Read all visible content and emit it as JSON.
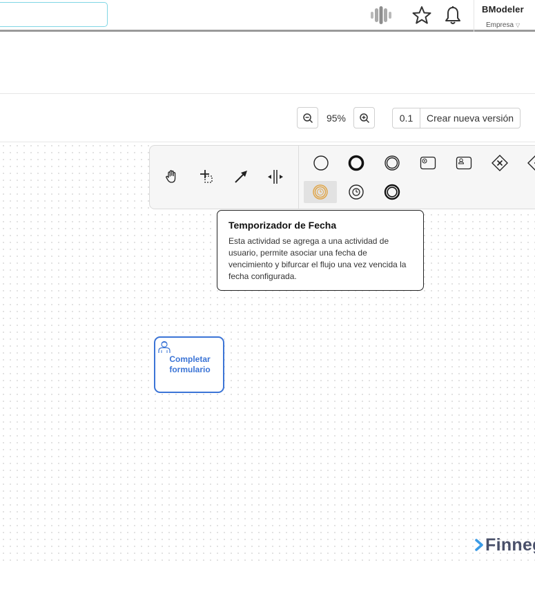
{
  "header": {
    "search_value": "",
    "user_name": "BModeler",
    "company": "Empresa",
    "icons": [
      "brand-logo-icon",
      "star-icon",
      "bell-icon",
      "chevron-down-icon"
    ]
  },
  "toolbar": {
    "zoom_level": "95%",
    "version_number": "0.1",
    "new_version_label": "Crear nueva versión"
  },
  "palette": {
    "tools": [
      "hand-tool-icon",
      "lasso-tool-icon",
      "connect-tool-icon",
      "space-tool-icon"
    ],
    "elements": [
      "start-event-icon",
      "end-event-icon",
      "intermediate-event-icon",
      "message-task-icon",
      "user-task-icon",
      "gateway-icon",
      "gateway-partial-icon",
      "date-timer-icon",
      "timer-event-icon",
      "intermediate-throw-event-icon"
    ],
    "active_element": "date-timer-icon"
  },
  "tooltip": {
    "title": "Temporizador de Fecha",
    "line1": "Esta actividad se agrega a una actividad de",
    "line2": "usuario, permite asociar una fecha de",
    "line3": "vencimiento y bifurcar el flujo una vez vencida la",
    "line4": "fecha configurada."
  },
  "canvas": {
    "task": {
      "line1": "Completar",
      "line2": "formulario"
    }
  },
  "footer": {
    "logo_text": "Finneg"
  },
  "colors": {
    "task_accent": "#3b74d6",
    "timer_active": "#e0a64a",
    "search_border": "#7fd6e4"
  }
}
